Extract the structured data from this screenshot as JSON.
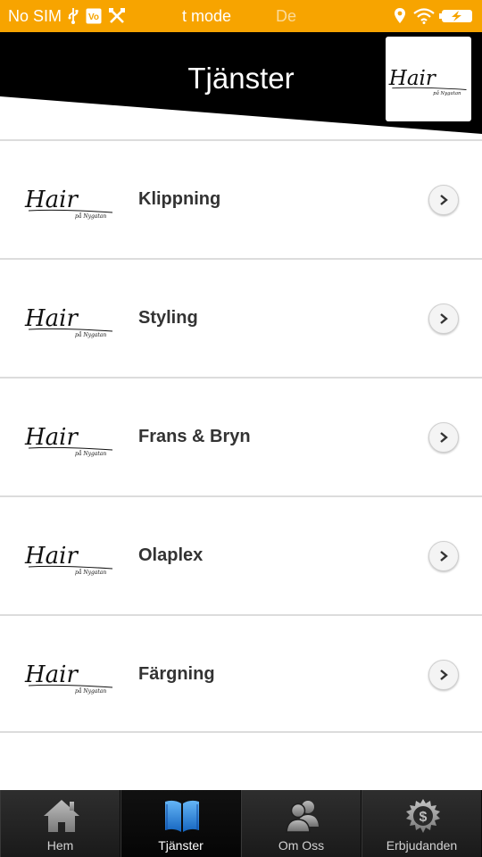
{
  "status_bar": {
    "carrier": "No SIM",
    "mode_text": "t mode",
    "faded_text": "De",
    "background": "#f7a400",
    "icons": [
      "usb-icon",
      "volte-icon",
      "tools-icon",
      "location-icon",
      "wifi-icon",
      "battery-charging-icon"
    ]
  },
  "header": {
    "title": "Tjänster",
    "logo_text": "Hair",
    "logo_subtext": "på Nygatan"
  },
  "services": {
    "items": [
      {
        "label": "Klippning",
        "logo_text": "Hair",
        "logo_subtext": "på Nygatan"
      },
      {
        "label": "Styling",
        "logo_text": "Hair",
        "logo_subtext": "på Nygatan"
      },
      {
        "label": "Frans & Bryn",
        "logo_text": "Hair",
        "logo_subtext": "på Nygatan"
      },
      {
        "label": "Olaplex",
        "logo_text": "Hair",
        "logo_subtext": "på Nygatan"
      },
      {
        "label": "Färgning",
        "logo_text": "Hair",
        "logo_subtext": "på Nygatan"
      }
    ]
  },
  "tab_bar": {
    "tabs": [
      {
        "label": "Hem",
        "icon": "home-icon",
        "active": false
      },
      {
        "label": "Tjänster",
        "icon": "book-icon",
        "active": true
      },
      {
        "label": "Om Oss",
        "icon": "people-icon",
        "active": false
      },
      {
        "label": "Erbjudanden",
        "icon": "dollar-badge-icon",
        "active": false
      }
    ],
    "active_color": "#1e88e5"
  }
}
